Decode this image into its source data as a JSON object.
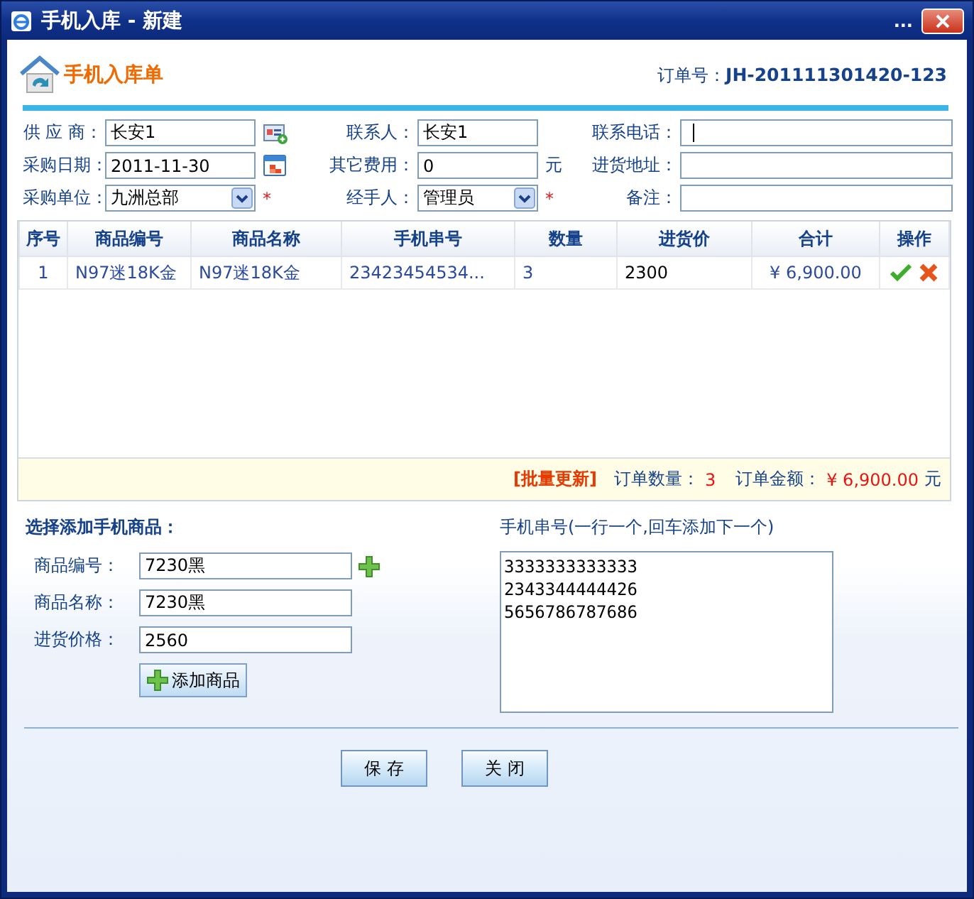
{
  "window": {
    "title": "手机入库 - 新建",
    "menu_glyph": "..."
  },
  "header": {
    "title": "手机入库单",
    "order_label": "订单号：",
    "order_number": "JH-201111301420-123"
  },
  "form": {
    "fields": [
      {
        "label": "供 应 商：",
        "kind": "text",
        "value": "长安1",
        "addon": {
          "kind": "lookup"
        }
      },
      {
        "label": "联系人：",
        "kind": "text",
        "value": "长安1"
      },
      {
        "label": "联系电话：",
        "kind": "text",
        "focused": true
      },
      {
        "label": "采购日期：",
        "kind": "text",
        "value": "2011-11-30",
        "addon": {
          "kind": "calendar"
        }
      },
      {
        "label": "其它费用：",
        "kind": "text",
        "value": "0",
        "unit": "元"
      },
      {
        "label": "进货地址：",
        "kind": "text"
      },
      {
        "label": "采购单位：",
        "kind": "select",
        "value": "九洲总部",
        "required_mark": "*"
      },
      {
        "label": "经手人：",
        "kind": "select",
        "value": "管理员",
        "required_mark": "*"
      },
      {
        "label": "备注：",
        "kind": "text"
      }
    ]
  },
  "table": {
    "columns": [
      {
        "label": "序号"
      },
      {
        "label": "商品编号"
      },
      {
        "label": "商品名称"
      },
      {
        "label": "手机串号"
      },
      {
        "label": "数量"
      },
      {
        "label": "进货价",
        "editable": true
      },
      {
        "label": "合计"
      },
      {
        "label": "操作"
      }
    ],
    "rows": [
      {
        "cells": [
          "1",
          "N97迷18K金",
          "N97迷18K金",
          "23423454534...",
          "3",
          "2300",
          "¥ 6,900.00"
        ],
        "actions": [
          {
            "kind": "confirm"
          },
          {
            "kind": "delete"
          }
        ]
      }
    ],
    "footer": {
      "batch_update": "[批量更新]",
      "count_label": "订单数量：",
      "count": "3",
      "amount_label": "订单金额：",
      "amount": "¥ 6,900.00",
      "unit": "元"
    }
  },
  "add_product": {
    "title": "选择添加手机商品：",
    "fields": [
      {
        "label": "商品编号：",
        "value": "7230黑",
        "addon": {
          "kind": "add"
        }
      },
      {
        "label": "商品名称：",
        "value": "7230黑"
      },
      {
        "label": "进货价格：",
        "value": "2560"
      }
    ],
    "button": "添加商品"
  },
  "serials": {
    "label": "手机串号(一行一个,回车添加下一个)",
    "lines": [
      "3333333333333",
      "2343344444426",
      "5656786787686"
    ]
  },
  "buttons": [
    "保 存",
    "关 闭"
  ]
}
